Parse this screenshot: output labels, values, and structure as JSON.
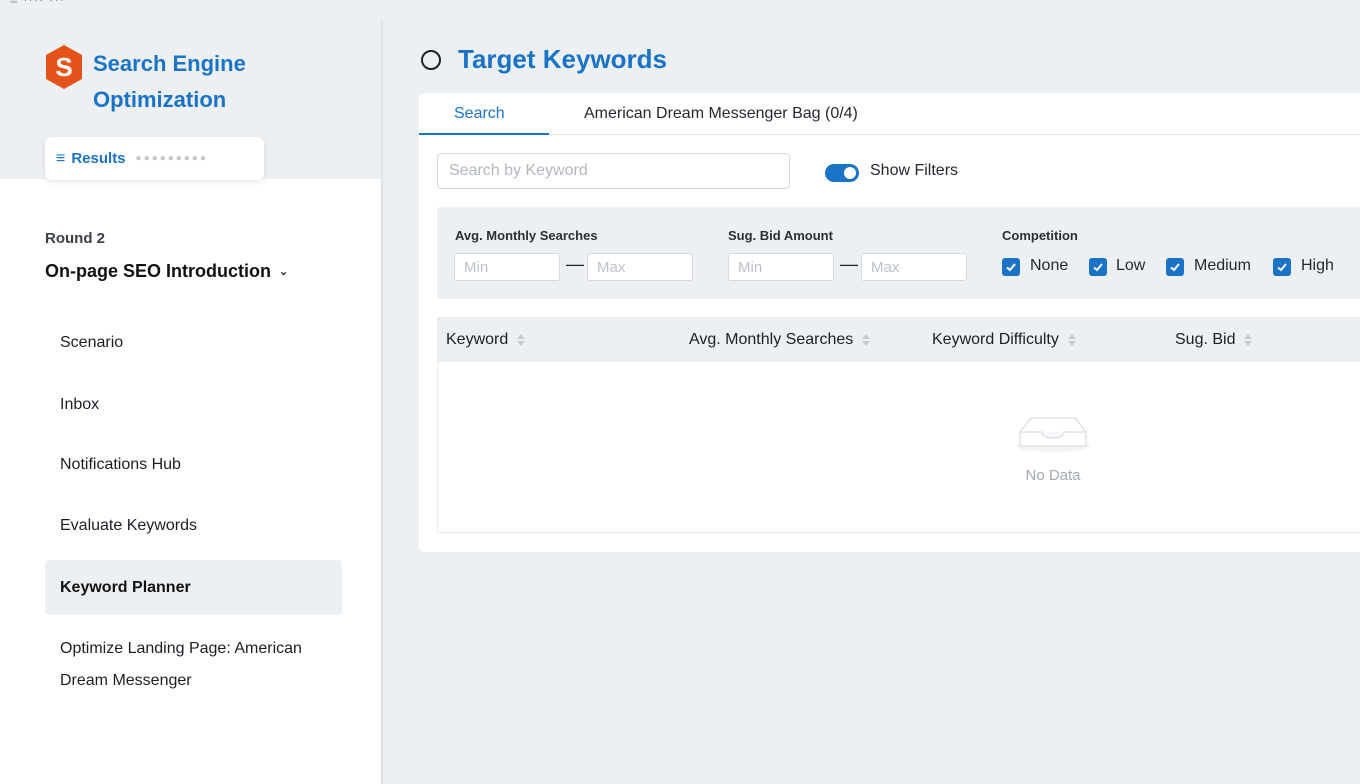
{
  "topcrop": "≡ ···· ···",
  "brand": {
    "title": "Search Engine Optimization",
    "color": "#1a73c7",
    "logo_color": "#e5531a",
    "logo_letter": "S"
  },
  "results_chip": {
    "label": "Results"
  },
  "round": {
    "label": "Round 2",
    "module": "On-page SEO Introduction"
  },
  "nav": {
    "items": [
      {
        "label": "Scenario",
        "active": false
      },
      {
        "label": "Inbox",
        "active": false
      },
      {
        "label": "Notifications Hub",
        "active": false
      },
      {
        "label": "Evaluate Keywords",
        "active": false
      },
      {
        "label": "Keyword Planner",
        "active": true
      },
      {
        "label": "Optimize Landing Page: American Dream Messenger",
        "active": false
      }
    ]
  },
  "page": {
    "title": "Target Keywords"
  },
  "tabs": [
    {
      "label": "Search",
      "active": true
    },
    {
      "label": "American Dream Messenger Bag (0/4)",
      "active": false
    }
  ],
  "search": {
    "placeholder": "Search by Keyword",
    "value": ""
  },
  "toggle": {
    "label": "Show Filters",
    "on": true
  },
  "filters": {
    "monthly": {
      "label": "Avg. Monthly Searches",
      "min_placeholder": "Min",
      "max_placeholder": "Max"
    },
    "bid": {
      "label": "Sug. Bid Amount",
      "min_placeholder": "Min",
      "max_placeholder": "Max"
    },
    "competition": {
      "label": "Competition",
      "options": [
        {
          "label": "None",
          "checked": true
        },
        {
          "label": "Low",
          "checked": true
        },
        {
          "label": "Medium",
          "checked": true
        },
        {
          "label": "High",
          "checked": true
        }
      ]
    },
    "dash": "—"
  },
  "table": {
    "columns": [
      "Keyword",
      "Avg. Monthly Searches",
      "Keyword Difficulty",
      "Sug. Bid"
    ],
    "rows": [],
    "empty_text": "No Data"
  }
}
